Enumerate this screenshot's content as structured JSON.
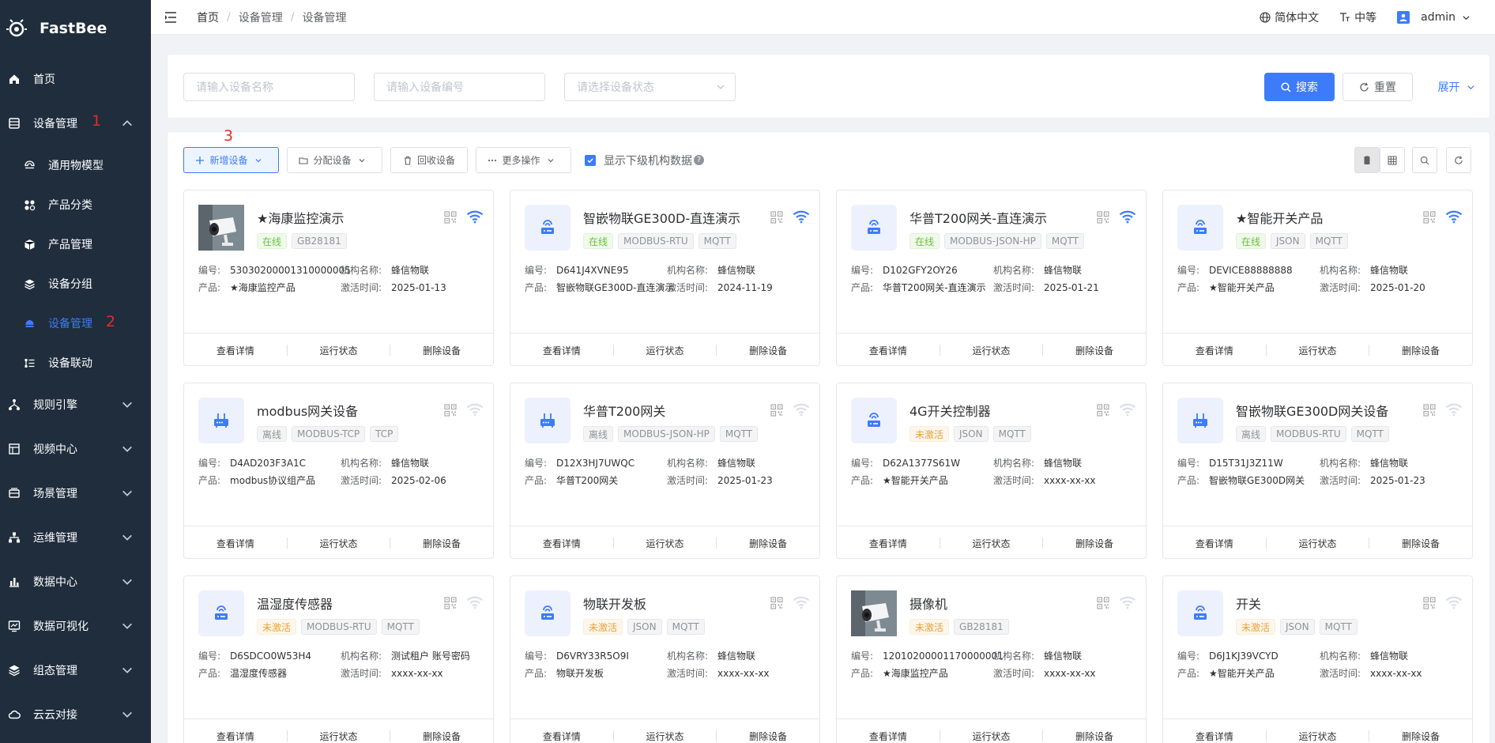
{
  "sidebar": {
    "logo_text": "FastBee",
    "items": [
      {
        "label": "首页",
        "icon": "home-icon"
      },
      {
        "label": "设备管理",
        "icon": "device-manage-icon",
        "expanded": true,
        "annotation": "1"
      },
      {
        "label": "规则引擎",
        "icon": "rule-engine-icon"
      },
      {
        "label": "视频中心",
        "icon": "video-center-icon"
      },
      {
        "label": "场景管理",
        "icon": "scene-icon"
      },
      {
        "label": "运维管理",
        "icon": "ops-icon"
      },
      {
        "label": "数据中心",
        "icon": "data-center-icon"
      },
      {
        "label": "数据可视化",
        "icon": "data-vis-icon"
      },
      {
        "label": "组态管理",
        "icon": "scada-icon"
      },
      {
        "label": "云云对接",
        "icon": "cloud-icon"
      }
    ],
    "sub_items": [
      {
        "label": "通用物模型",
        "icon": "model-icon"
      },
      {
        "label": "产品分类",
        "icon": "category-icon"
      },
      {
        "label": "产品管理",
        "icon": "product-icon"
      },
      {
        "label": "设备分组",
        "icon": "group-icon"
      },
      {
        "label": "设备管理",
        "icon": "device-icon",
        "active": true,
        "annotation": "2"
      },
      {
        "label": "设备联动",
        "icon": "linkage-icon"
      }
    ]
  },
  "header": {
    "breadcrumb": [
      "首页",
      "设备管理",
      "设备管理"
    ],
    "language": "简体中文",
    "font_size": "中等",
    "user": "admin"
  },
  "search": {
    "name_placeholder": "请输入设备名称",
    "number_placeholder": "请输入设备编号",
    "status_placeholder": "请选择设备状态",
    "search_label": "搜索",
    "reset_label": "重置",
    "expand_label": "展开"
  },
  "toolbar": {
    "add_label": "新增设备",
    "add_annotation": "3",
    "assign_label": "分配设备",
    "recycle_label": "回收设备",
    "more_label": "更多操作",
    "show_sub_label": "显示下级机构数据",
    "help": "?"
  },
  "labels": {
    "number": "编号:",
    "org": "机构名称:",
    "product": "产品:",
    "activate": "激活时间:",
    "detail": "查看详情",
    "running": "运行状态",
    "delete": "删除设备"
  },
  "devices": [
    {
      "name": "★海康监控演示",
      "img": "camera",
      "status": "在线",
      "status_type": "online",
      "tags": [
        "GB28181"
      ],
      "number": "53030200001310000005",
      "org": "蜂信物联",
      "product": "★海康监控产品",
      "activate": "2025-01-13",
      "wifi": "strong"
    },
    {
      "name": "智嵌物联GE300D-直连演示",
      "img": "device",
      "status": "在线",
      "status_type": "online",
      "tags": [
        "MODBUS-RTU",
        "MQTT"
      ],
      "number": "D641J4XVNE95",
      "org": "蜂信物联",
      "product": "智嵌物联GE300D-直连演示",
      "activate": "2024-11-19",
      "wifi": "strong"
    },
    {
      "name": "华普T200网关-直连演示",
      "img": "device",
      "status": "在线",
      "status_type": "online",
      "tags": [
        "MODBUS-JSON-HP",
        "MQTT"
      ],
      "number": "D102GFY2OY26",
      "org": "蜂信物联",
      "product": "华普T200网关-直连演示",
      "activate": "2025-01-21",
      "wifi": "strong"
    },
    {
      "name": "★智能开关产品",
      "img": "device",
      "status": "在线",
      "status_type": "online",
      "tags": [
        "JSON",
        "MQTT"
      ],
      "number": "DEVICE88888888",
      "org": "蜂信物联",
      "product": "★智能开关产品",
      "activate": "2025-01-20",
      "wifi": "strong"
    },
    {
      "name": "modbus网关设备",
      "img": "gateway",
      "status": "离线",
      "status_type": "offline",
      "tags": [
        "MODBUS-TCP",
        "TCP"
      ],
      "number": "D4AD203F3A1C",
      "org": "蜂信物联",
      "product": "modbus协议组产品",
      "activate": "2025-02-06",
      "wifi": "weak"
    },
    {
      "name": "华普T200网关",
      "img": "gateway",
      "status": "离线",
      "status_type": "offline",
      "tags": [
        "MODBUS-JSON-HP",
        "MQTT"
      ],
      "number": "D12X3HJ7UWQC",
      "org": "蜂信物联",
      "product": "华普T200网关",
      "activate": "2025-01-23",
      "wifi": "weak"
    },
    {
      "name": "4G开关控制器",
      "img": "device",
      "status": "未激活",
      "status_type": "inactive",
      "tags": [
        "JSON",
        "MQTT"
      ],
      "number": "D62A1377S61W",
      "org": "蜂信物联",
      "product": "★智能开关产品",
      "activate": "xxxx-xx-xx",
      "wifi": "weak"
    },
    {
      "name": "智嵌物联GE300D网关设备",
      "img": "gateway",
      "status": "离线",
      "status_type": "offline",
      "tags": [
        "MODBUS-RTU",
        "MQTT"
      ],
      "number": "D15T31J3Z11W",
      "org": "蜂信物联",
      "product": "智嵌物联GE300D网关",
      "activate": "2025-01-23",
      "wifi": "weak"
    },
    {
      "name": "温湿度传感器",
      "img": "device",
      "status": "未激活",
      "status_type": "inactive",
      "tags": [
        "MODBUS-RTU",
        "MQTT"
      ],
      "number": "D6SDCO0W53H4",
      "org": "测试租户 账号密码",
      "product": "温湿度传感器",
      "activate": "xxxx-xx-xx",
      "wifi": "weak"
    },
    {
      "name": "物联开发板",
      "img": "device",
      "status": "未激活",
      "status_type": "inactive",
      "tags": [
        "JSON",
        "MQTT"
      ],
      "number": "D6VRY33R5O9I",
      "org": "蜂信物联",
      "product": "物联开发板",
      "activate": "xxxx-xx-xx",
      "wifi": "weak"
    },
    {
      "name": "摄像机",
      "img": "camera",
      "status": "未激活",
      "status_type": "inactive",
      "tags": [
        "GB28181"
      ],
      "number": "12010200001170000001",
      "org": "蜂信物联",
      "product": "★海康监控产品",
      "activate": "xxxx-xx-xx",
      "wifi": "weak"
    },
    {
      "name": "开关",
      "img": "device",
      "status": "未激活",
      "status_type": "inactive",
      "tags": [
        "JSON",
        "MQTT"
      ],
      "number": "D6J1KJ39VCYD",
      "org": "蜂信物联",
      "product": "★智能开关产品",
      "activate": "xxxx-xx-xx",
      "wifi": "weak"
    }
  ],
  "colors": {
    "primary": "#3d7bfa",
    "sidebar_bg": "#1f2d3d",
    "annotation": "#e52a2a",
    "online": "#67c23a",
    "inactive": "#e6a23c"
  }
}
